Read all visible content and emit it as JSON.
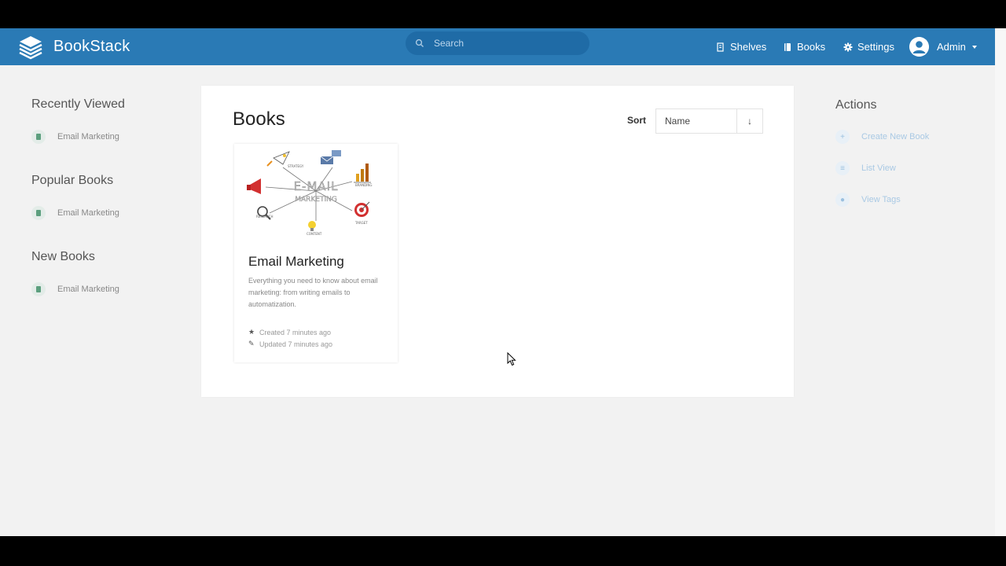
{
  "app": {
    "name": "BookStack"
  },
  "header": {
    "search_placeholder": "Search",
    "nav": {
      "shelves": "Shelves",
      "books": "Books",
      "settings": "Settings",
      "user": "Admin"
    }
  },
  "sidebar_left": {
    "sections": [
      {
        "heading": "Recently Viewed",
        "items": [
          "Email Marketing"
        ]
      },
      {
        "heading": "Popular Books",
        "items": [
          "Email Marketing"
        ]
      },
      {
        "heading": "New Books",
        "items": [
          "Email Marketing"
        ]
      }
    ]
  },
  "main": {
    "title": "Books",
    "sort_label": "Sort",
    "sort_value": "Name",
    "sort_direction": "↓",
    "books": [
      {
        "title": "Email Marketing",
        "description": "Everything you need to know about email marketing: from writing emails to automatization.",
        "created": "Created 7 minutes ago",
        "updated": "Updated 7 minutes ago",
        "cover_text": [
          "E-MAIL",
          "MARKETING"
        ],
        "cover_labels": [
          "STRATEGY",
          "RESEARCH",
          "CONTENT",
          "TARGET",
          "BRANDING"
        ]
      }
    ]
  },
  "sidebar_right": {
    "heading": "Actions",
    "items": [
      {
        "label": "Create New Book",
        "icon": "plus-icon"
      },
      {
        "label": "List View",
        "icon": "list-icon"
      },
      {
        "label": "View Tags",
        "icon": "tag-icon"
      }
    ]
  },
  "colors": {
    "header": "#2a7ab5",
    "accent_green": "#5c9f7e",
    "action_text": "#a9c9e4"
  }
}
